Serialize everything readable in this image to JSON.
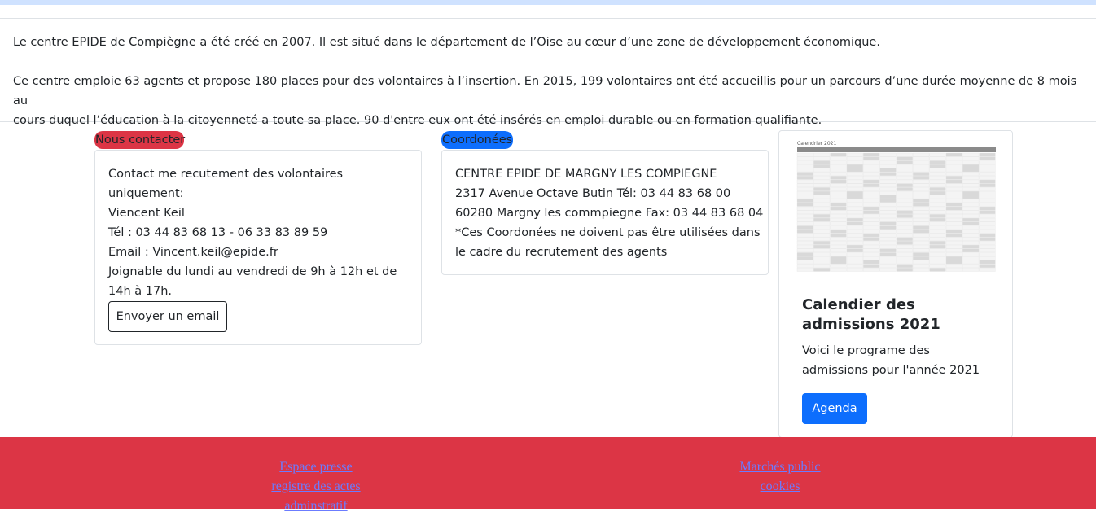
{
  "intro": {
    "p1": "Le centre EPIDE de Compiègne a été créé en 2007. Il est situé dans le département de l’Oise au cœur d’une zone de développement économique.",
    "p2_line1": "Ce centre emploie 63 agents et propose 180 places pour des volontaires à l’insertion. En 2015, 199 volontaires ont été accueillis pour un parcours d’une durée moyenne de 8 mois au",
    "p2_line2": "cours duquel l’éducation à la citoyenneté a toute sa place. 90 d'entre eux ont été insérés en emploi durable ou en formation qualifiante."
  },
  "contact": {
    "badge": "Nous contacter",
    "lines": [
      "Contact me recutement des volontaires",
      "uniquement:",
      "Viencent Keil",
      "Tél : 03 44 83 68 13 - 06 33 83 89 59",
      "Email : Vincent.keil@epide.fr",
      "Joignable du lundi au vendredi de 9h à 12h et de",
      "14h à 17h."
    ],
    "button": "Envoyer un email"
  },
  "coordonnees": {
    "badge": "Coordonées",
    "lines": [
      "CENTRE EPIDE DE MARGNY LES COMPIEGNE",
      "2317 Avenue Octave Butin Tél: 03 44 83 68 00",
      "60280 Margny les commpiegne Fax: 03 44 83 68 04",
      "*Ces Coordonées ne doivent pas être utilisées dans",
      "le cadre du recrutement des agents"
    ]
  },
  "calendar": {
    "image_caption": "Calendrier 2021",
    "title": "Calendier des admissions 2021",
    "text": "Voici le programe des admissions pour l'année 2021",
    "button": "Agenda"
  },
  "footer": {
    "links_left": [
      "Espace presse",
      "registre des actes",
      "adminstratif"
    ],
    "links_right": [
      "Marchés public",
      "cookies"
    ]
  },
  "colors": {
    "danger": "#dc3545",
    "primary": "#0d6efd",
    "link": "#6b7cff"
  }
}
